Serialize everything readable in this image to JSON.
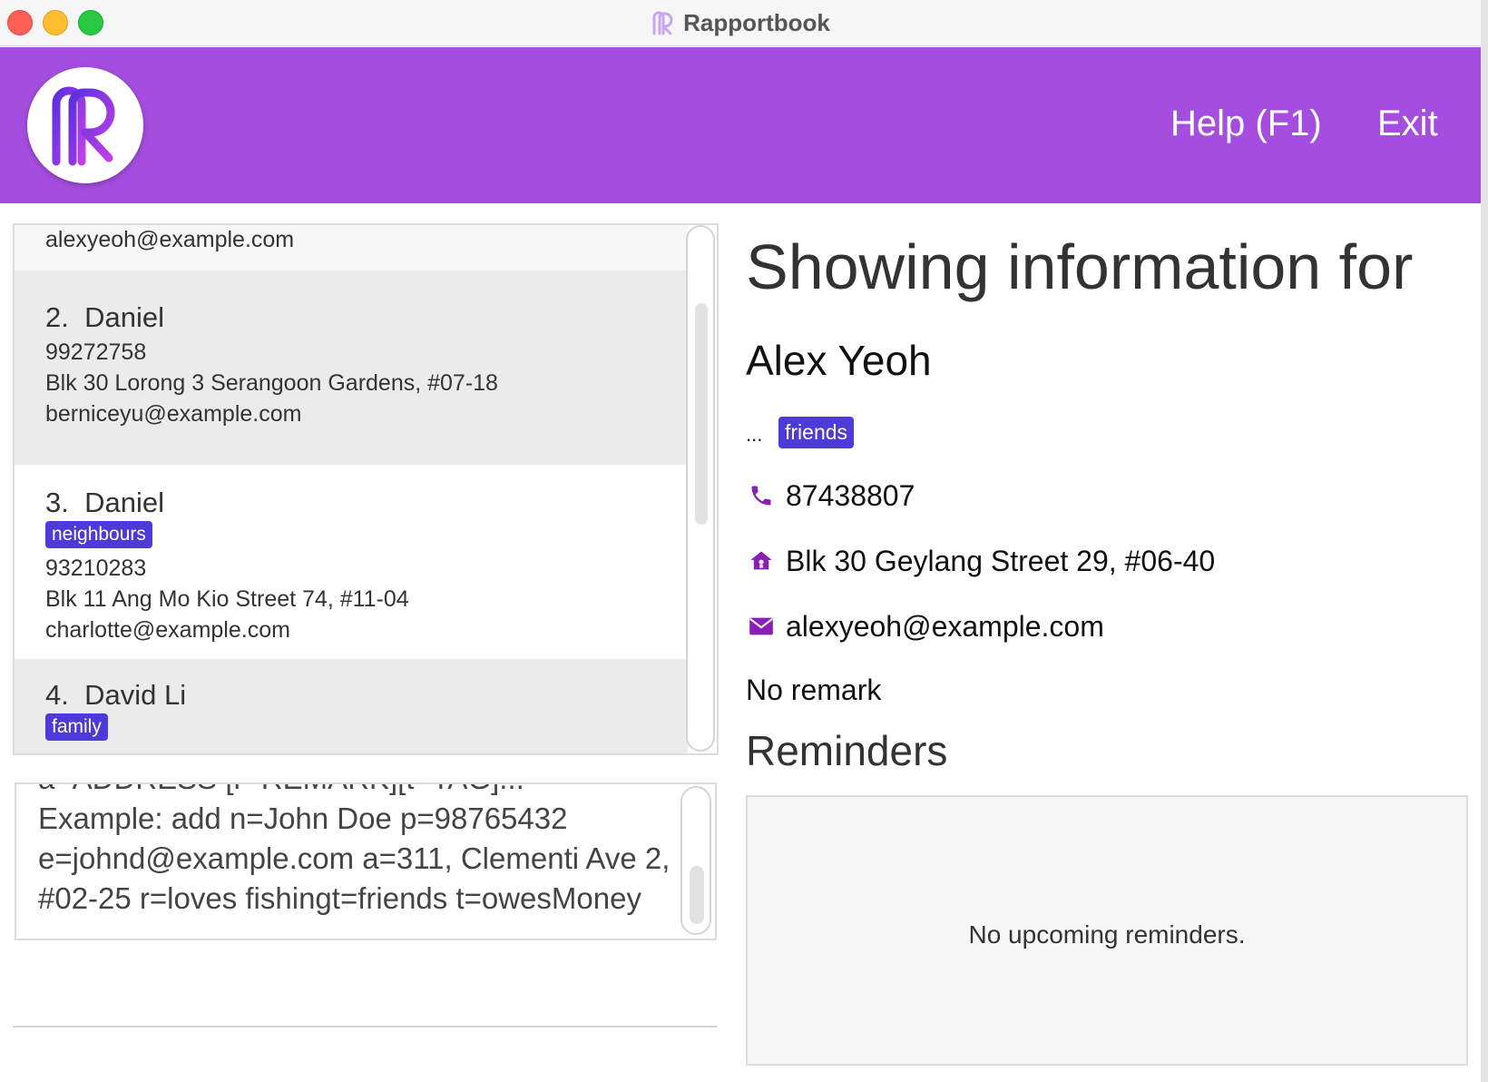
{
  "window": {
    "title": "Rapportbook"
  },
  "header": {
    "menu": {
      "help_label": "Help (F1)",
      "exit_label": "Exit"
    }
  },
  "person_list": {
    "partial_top_email": "alexyeoh@example.com",
    "cards": [
      {
        "index": "2.",
        "name": "Daniel",
        "tags": [],
        "phone": "99272758",
        "address": "Blk 30 Lorong 3 Serangoon Gardens, #07-18",
        "email": "berniceyu@example.com"
      },
      {
        "index": "3.",
        "name": "Daniel",
        "tags": [
          "neighbours"
        ],
        "phone": "93210283",
        "address": "Blk 11 Ang Mo Kio Street 74, #11-04",
        "email": "charlotte@example.com"
      },
      {
        "index": "4.",
        "name": "David Li",
        "tags": [
          "family"
        ]
      }
    ]
  },
  "result_display": {
    "lines": [
      "a=ADDRESS [r=REMARK][t=TAG]...",
      "Example: add n=John Doe p=98765432",
      "e=johnd@example.com a=311, Clementi Ave 2,",
      "#02-25 r=loves fishingt=friends t=owesMoney"
    ]
  },
  "detail": {
    "heading": "Showing information for",
    "name": "Alex Yeoh",
    "ellipsis": "...",
    "tag": "friends",
    "phone": "87438807",
    "address": "Blk 30 Geylang Street 29, #06-40",
    "email": "alexyeoh@example.com",
    "remark": "No remark",
    "reminders_heading": "Reminders",
    "reminders_empty": "No upcoming reminders."
  },
  "colors": {
    "header": "#a54ddf",
    "tag": "#4d3ad8",
    "icon": "#8a1fb8"
  },
  "icons": [
    "phone-icon",
    "home-icon",
    "mail-icon",
    "app-logo"
  ]
}
